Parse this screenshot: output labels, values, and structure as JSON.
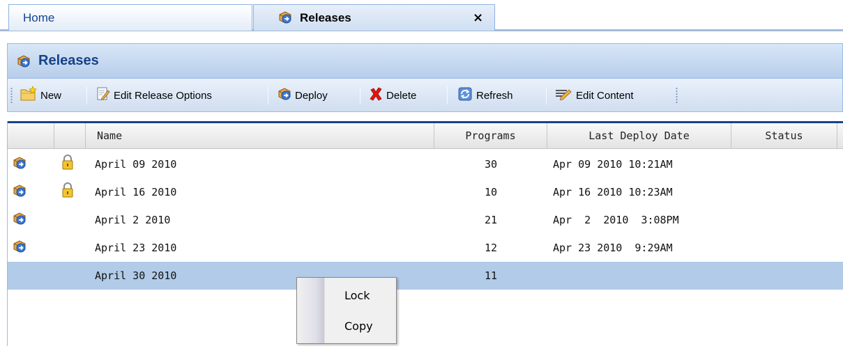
{
  "tabs": [
    {
      "label": "Home"
    },
    {
      "label": "Releases",
      "close": "×"
    }
  ],
  "panel": {
    "title": "Releases"
  },
  "toolbar": {
    "new": "New",
    "edit_release_options": "Edit Release Options",
    "deploy": "Deploy",
    "delete": "Delete",
    "refresh": "Refresh",
    "edit_content": "Edit Content"
  },
  "grid": {
    "columns": [
      "Name",
      "Programs",
      "Last Deploy Date",
      "Status"
    ],
    "rows": [
      {
        "name": "April 09 2010",
        "programs": "30",
        "last_deploy": "Apr 09 2010 10:21AM",
        "status": "",
        "icon": "release-package-icon",
        "locked": true
      },
      {
        "name": "April 16 2010",
        "programs": "10",
        "last_deploy": "Apr 16 2010 10:23AM",
        "status": "",
        "icon": "release-package-icon",
        "locked": true
      },
      {
        "name": "April 2 2010",
        "programs": "21",
        "last_deploy": "Apr  2  2010  3:08PM",
        "status": "",
        "icon": "release-package-icon",
        "locked": false
      },
      {
        "name": "April 23 2010",
        "programs": "12",
        "last_deploy": "Apr 23 2010  9:29AM",
        "status": "",
        "icon": "release-package-icon",
        "locked": false
      },
      {
        "name": "April 30 2010",
        "programs": "11",
        "last_deploy": "",
        "status": "",
        "icon": "",
        "locked": false,
        "selected": true
      }
    ]
  },
  "context_menu": {
    "items": [
      "Lock",
      "Copy"
    ]
  },
  "colors": {
    "selection": "#b1cbe8",
    "panel_title": "#15428b",
    "border": "#99bbe8",
    "delete_red": "#e3140f"
  }
}
